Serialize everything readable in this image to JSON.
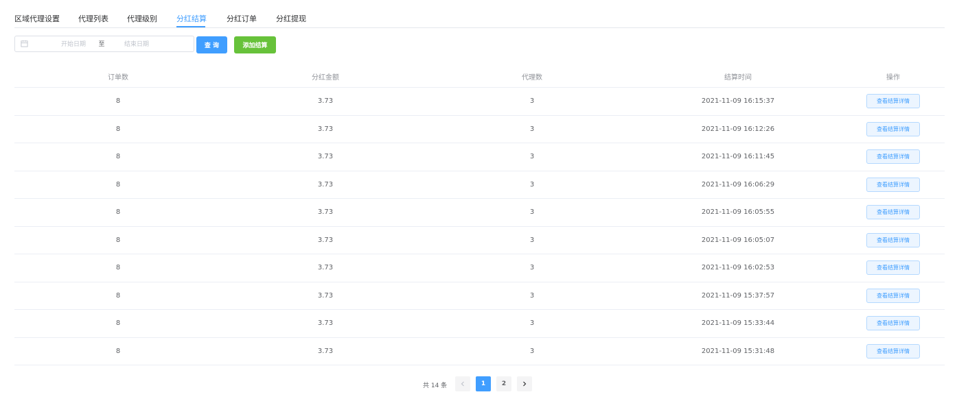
{
  "tabs": [
    {
      "label": "区域代理设置"
    },
    {
      "label": "代理列表"
    },
    {
      "label": "代理级别"
    },
    {
      "label": "分红结算"
    },
    {
      "label": "分红订单"
    },
    {
      "label": "分红提现"
    }
  ],
  "active_tab": "分红结算",
  "toolbar": {
    "date_start_placeholder": "开始日期",
    "date_separator": "至",
    "date_end_placeholder": "结束日期",
    "query_label": "查 询",
    "add_label": "添加结算"
  },
  "table": {
    "columns": [
      "订单数",
      "分红金额",
      "代理数",
      "结算时间",
      "操作"
    ],
    "rows": [
      {
        "orders": "8",
        "amount": "3.73",
        "agents": "3",
        "time": "2021-11-09 16:15:37",
        "action": "查看结算详情"
      },
      {
        "orders": "8",
        "amount": "3.73",
        "agents": "3",
        "time": "2021-11-09 16:12:26",
        "action": "查看结算详情"
      },
      {
        "orders": "8",
        "amount": "3.73",
        "agents": "3",
        "time": "2021-11-09 16:11:45",
        "action": "查看结算详情"
      },
      {
        "orders": "8",
        "amount": "3.73",
        "agents": "3",
        "time": "2021-11-09 16:06:29",
        "action": "查看结算详情"
      },
      {
        "orders": "8",
        "amount": "3.73",
        "agents": "3",
        "time": "2021-11-09 16:05:55",
        "action": "查看结算详情"
      },
      {
        "orders": "8",
        "amount": "3.73",
        "agents": "3",
        "time": "2021-11-09 16:05:07",
        "action": "查看结算详情"
      },
      {
        "orders": "8",
        "amount": "3.73",
        "agents": "3",
        "time": "2021-11-09 16:02:53",
        "action": "查看结算详情"
      },
      {
        "orders": "8",
        "amount": "3.73",
        "agents": "3",
        "time": "2021-11-09 15:37:57",
        "action": "查看结算详情"
      },
      {
        "orders": "8",
        "amount": "3.73",
        "agents": "3",
        "time": "2021-11-09 15:33:44",
        "action": "查看结算详情"
      },
      {
        "orders": "8",
        "amount": "3.73",
        "agents": "3",
        "time": "2021-11-09 15:31:48",
        "action": "查看结算详情"
      }
    ]
  },
  "pagination": {
    "total_text": "共 14 条",
    "pages": [
      "1",
      "2"
    ],
    "current_page": "1",
    "prev_icon": "chevron-left-icon",
    "next_icon": "chevron-right-icon"
  },
  "colors": {
    "primary": "#409eff",
    "success": "#67c23a",
    "border": "#ebeef5"
  }
}
